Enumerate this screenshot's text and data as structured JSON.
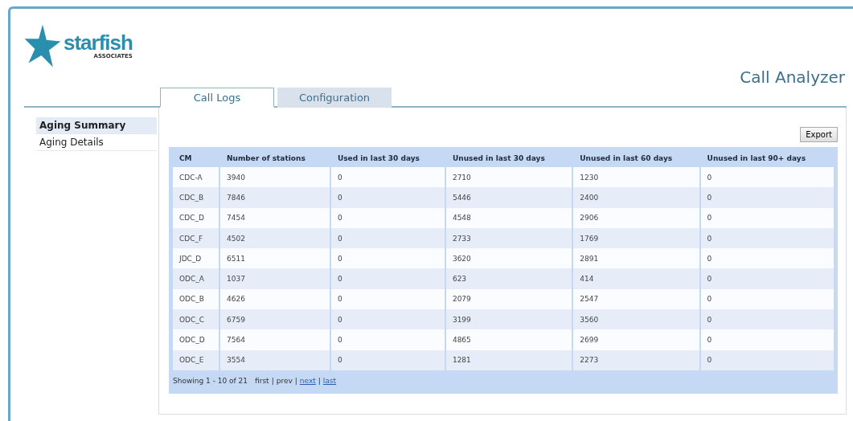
{
  "logo": {
    "name": "starfish",
    "tagline": "ASSOCIATES"
  },
  "app_title": "Call Analyzer",
  "tabs": [
    {
      "label": "Call Logs",
      "selected": true
    },
    {
      "label": "Configuration",
      "selected": false
    }
  ],
  "sidebar": {
    "items": [
      {
        "label": "Aging Summary",
        "selected": true
      },
      {
        "label": "Aging Details",
        "selected": false
      }
    ]
  },
  "export_button": "Export",
  "table": {
    "columns": [
      "CM",
      "Number of stations",
      "Used in last 30 days",
      "Unused in last 30 days",
      "Unused in last 60 days",
      "Unused in last 90+ days"
    ],
    "rows": [
      [
        "CDC-A",
        "3940",
        "0",
        "2710",
        "1230",
        "0"
      ],
      [
        "CDC_B",
        "7846",
        "0",
        "5446",
        "2400",
        "0"
      ],
      [
        "CDC_D",
        "7454",
        "0",
        "4548",
        "2906",
        "0"
      ],
      [
        "CDC_F",
        "4502",
        "0",
        "2733",
        "1769",
        "0"
      ],
      [
        "JDC_D",
        "6511",
        "0",
        "3620",
        "2891",
        "0"
      ],
      [
        "ODC_A",
        "1037",
        "0",
        "623",
        "414",
        "0"
      ],
      [
        "ODC_B",
        "4626",
        "0",
        "2079",
        "2547",
        "0"
      ],
      [
        "ODC_C",
        "6759",
        "0",
        "3199",
        "3560",
        "0"
      ],
      [
        "ODC_D",
        "7564",
        "0",
        "4865",
        "2699",
        "0"
      ],
      [
        "ODC_E",
        "3554",
        "0",
        "1281",
        "2273",
        "0"
      ]
    ]
  },
  "pager": {
    "summary": "Showing 1 - 10 of 21",
    "separator": "|",
    "links": [
      {
        "label": "first",
        "disabled": true
      },
      {
        "label": "prev",
        "disabled": true
      },
      {
        "label": "next",
        "disabled": false
      },
      {
        "label": "last",
        "disabled": false
      }
    ]
  }
}
